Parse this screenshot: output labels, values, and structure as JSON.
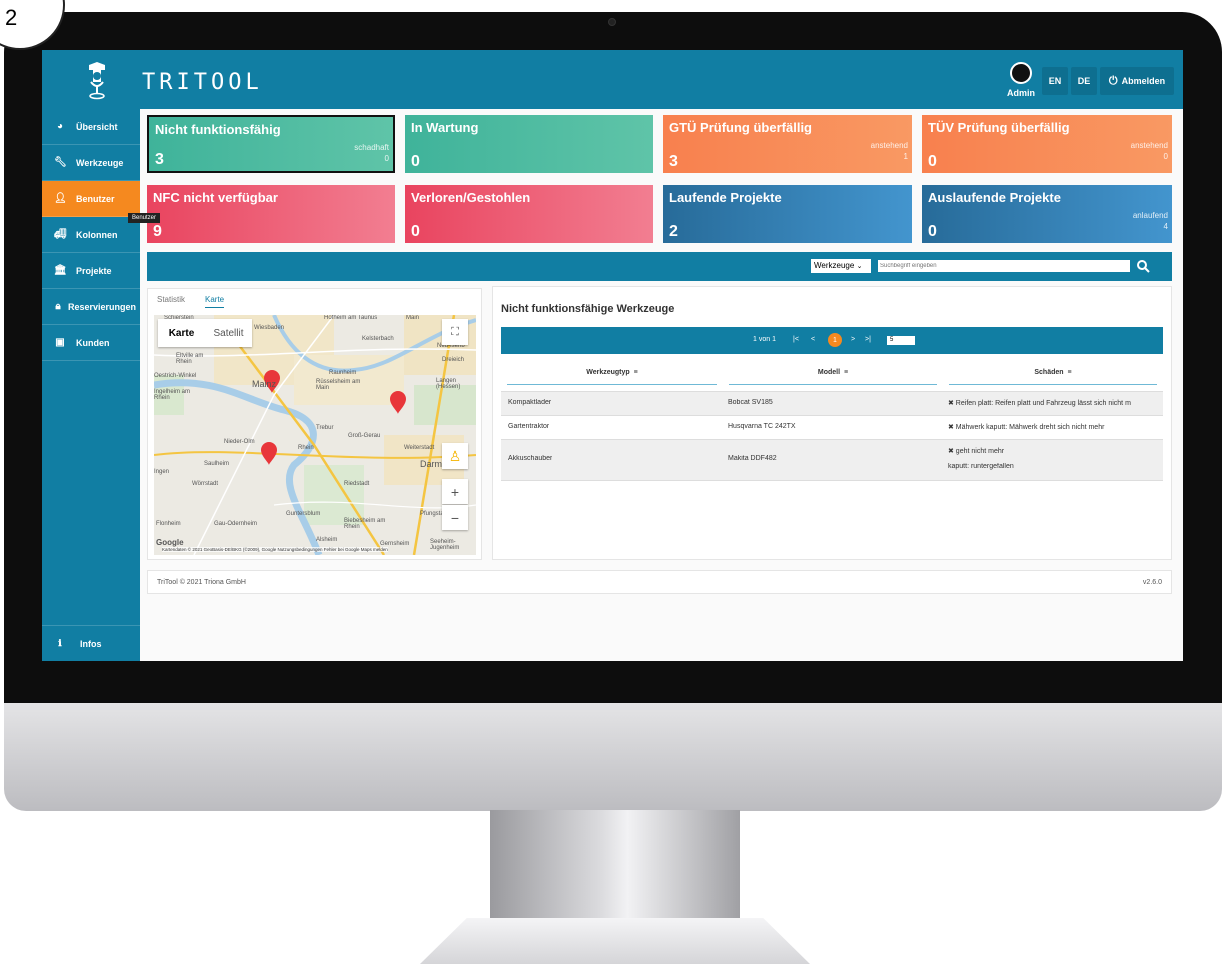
{
  "step_badge": "2",
  "header": {
    "brand": "TRITOOL",
    "user_label": "Admin",
    "lang_en": "EN",
    "lang_de": "DE",
    "logout_label": "Abmelden"
  },
  "sidebar": {
    "items": [
      {
        "label": "Übersicht",
        "icon": "dashboard-icon"
      },
      {
        "label": "Werkzeuge",
        "icon": "wrench-icon"
      },
      {
        "label": "Benutzer",
        "icon": "user-icon",
        "active": true
      },
      {
        "label": "Kolonnen",
        "icon": "truck-icon"
      },
      {
        "label": "Projekte",
        "icon": "bank-icon"
      },
      {
        "label": "Reservierungen",
        "icon": "lock-icon"
      },
      {
        "label": "Kunden",
        "icon": "id-card-icon"
      }
    ],
    "bottom_item": {
      "label": "Infos",
      "icon": "info-icon"
    },
    "tooltip": "Benutzer"
  },
  "cards": [
    {
      "title": "Nicht funktionsfähig",
      "value": "3",
      "sub_label": "schadhaft",
      "sub_value": "0",
      "color": "#3fb39a"
    },
    {
      "title": "In Wartung",
      "value": "0",
      "color": "#3fb39a"
    },
    {
      "title": "GTÜ Prüfung überfällig",
      "value": "3",
      "sub_label": "anstehend",
      "sub_value": "1",
      "color": "#f8804e"
    },
    {
      "title": "TÜV Prüfung überfällig",
      "value": "0",
      "sub_label": "anstehend",
      "sub_value": "0",
      "color": "#f8804e"
    },
    {
      "title": "NFC nicht verfügbar",
      "value": "9",
      "color": "#e9445f"
    },
    {
      "title": "Verloren/Gestohlen",
      "value": "0",
      "color": "#e9445f"
    },
    {
      "title": "Laufende Projekte",
      "value": "2",
      "color": "#276b99"
    },
    {
      "title": "Auslaufende Projekte",
      "value": "0",
      "sub_label": "anlaufend",
      "sub_value": "4",
      "color": "#276b99"
    }
  ],
  "search": {
    "category": "Werkzeuge",
    "placeholder": "Suchbegriff eingeben"
  },
  "map_panel": {
    "tabs": [
      "Statistik",
      "Karte"
    ],
    "active_tab": "Karte",
    "map_type": {
      "map": "Karte",
      "satellite": "Satellit"
    },
    "places": [
      "Wiesbaden",
      "Hofheim am Taunus",
      "Kelsterbach",
      "Main",
      "Neu-Isenb",
      "Eltville am Rhein",
      "Dreieich",
      "Schierstein",
      "Raunheim",
      "Rüsselsheim am Main",
      "Langen (Hessen)",
      "Oestrich-Winkel",
      "Ingelheim am Rhein",
      "Mainz",
      "Trebur",
      "Groß-Gerau",
      "Nieder-Olm",
      "Weiterstadt",
      "Saulheim",
      "Darmstadt",
      "Wörrstadt",
      "Riedstadt",
      "Guntersblum",
      "Pfungstadt",
      "Flonheim",
      "Gau-Odernheim",
      "Biebesheim am Rhein",
      "Alsheim",
      "Gernsheim",
      "Seeheim-Jugenheim",
      "Rhein",
      "Ingen"
    ],
    "attribution": "Kartendaten © 2021 GeoBasis-DE/BKG (©2009), Google   Nutzungsbedingungen   Fehler bei Google Maps melden",
    "google": "Google"
  },
  "table": {
    "title": "Nicht funktionsfähige Werkzeuge",
    "pager": {
      "info": "1 von 1",
      "current": "1",
      "page_size": "5"
    },
    "columns": [
      "Werkzeugtyp",
      "Modell",
      "Schäden"
    ],
    "rows": [
      {
        "type": "Kompaktlader",
        "model": "Bobcat SV185",
        "damage": [
          "✖ Reifen platt: Reifen platt und Fahrzeug lässt sich nicht m"
        ]
      },
      {
        "type": "Gartentraktor",
        "model": "Husqvarna TC 242TX",
        "damage": [
          "✖ Mähwerk kaputt: Mähwerk dreht sich nicht mehr"
        ]
      },
      {
        "type": "Akkuschauber",
        "model": "Makita DDF482",
        "damage": [
          "✖ geht nicht mehr",
          "kaputt: runtergefallen"
        ]
      }
    ]
  },
  "footer": {
    "copyright": "TriTool © 2021 Triona GmbH",
    "version": "v2.6.0"
  }
}
